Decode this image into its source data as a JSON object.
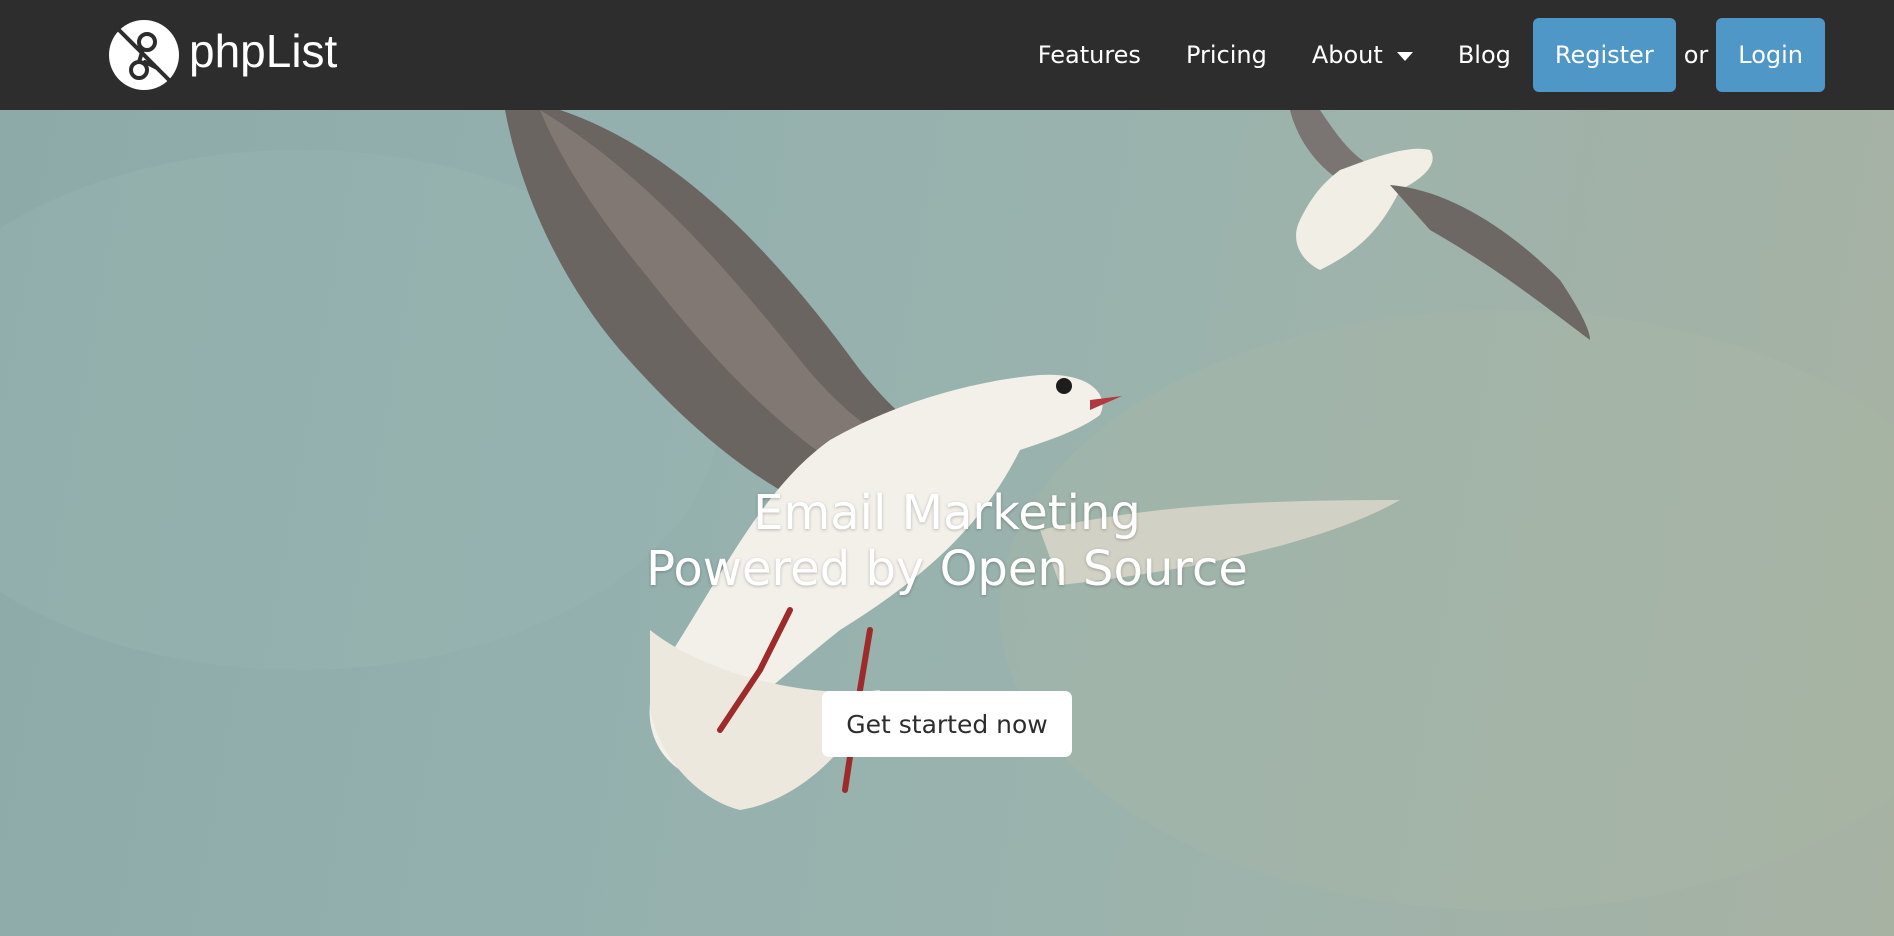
{
  "brand": {
    "name": "phpList",
    "logo_icon": "phplist-logo-icon"
  },
  "nav": {
    "features": "Features",
    "pricing": "Pricing",
    "about": "About",
    "blog": "Blog",
    "register": "Register",
    "or": "or",
    "login": "Login"
  },
  "hero": {
    "title_line1": "Email Marketing",
    "title_line2": "Powered by Open Source",
    "cta": "Get started now"
  },
  "colors": {
    "navbar_bg": "#2d2d2d",
    "button_blue": "#4f97c6",
    "hero_sky": "#93b0ae"
  }
}
